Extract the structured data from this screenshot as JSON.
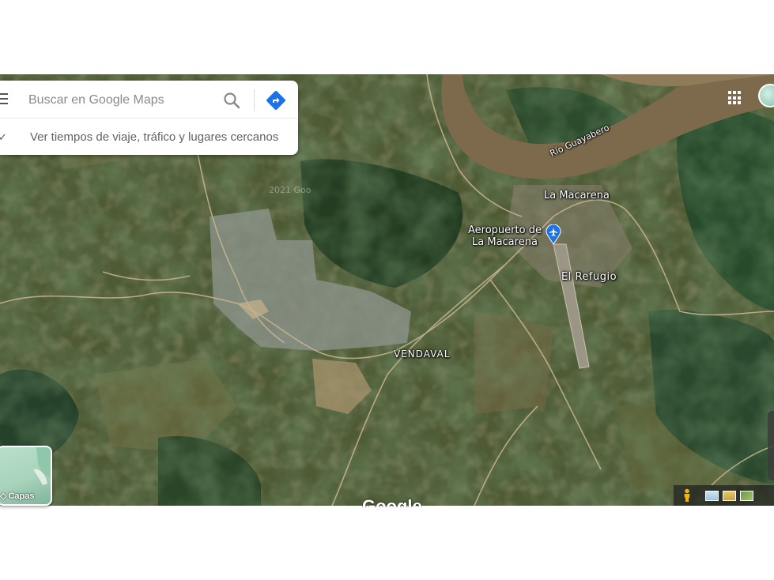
{
  "search": {
    "placeholder": "Buscar en Google Maps",
    "hint": "Ver tiempos de viaje, tráfico y lugares cercanos"
  },
  "map": {
    "labels": {
      "town_macarena": "La Macarena",
      "airport": "Aeropuerto de\nLa Macarena",
      "el_refugio": "El Refugio",
      "vendaval": "VENDAVAL",
      "river": "Río Guayabero",
      "copyright_watermark": "2021 Goo"
    }
  },
  "controls": {
    "layers_label": "Capas",
    "logo_text": "Google"
  },
  "icons": {
    "menu": "menu-icon",
    "search": "search-icon",
    "directions": "directions-icon",
    "airport": "airport-icon",
    "apps": "apps-grid-icon",
    "pegman": "pegman-icon",
    "layers": "layers-icon"
  },
  "colors": {
    "directions_blue": "#1a73e8",
    "river": "#7d6a4c",
    "forest": "#2f4a2c"
  }
}
